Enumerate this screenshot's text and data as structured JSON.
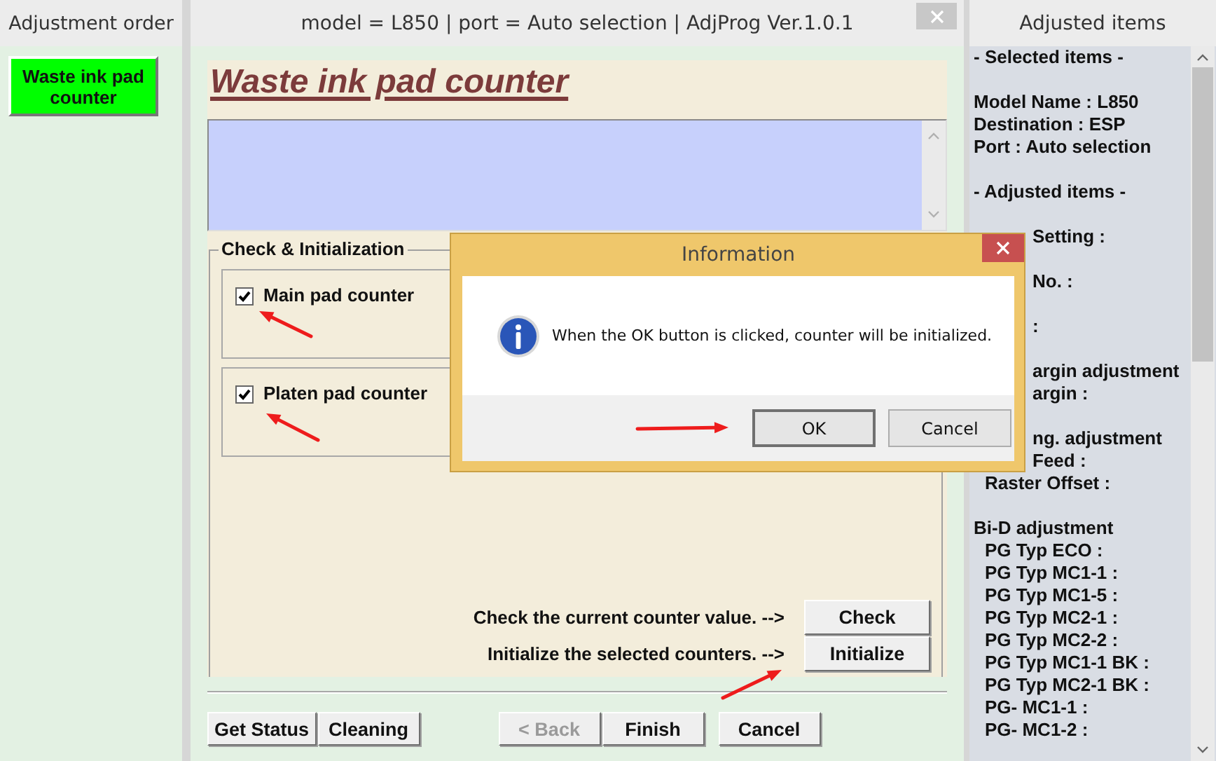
{
  "left_panel": {
    "title": "Adjustment order",
    "items": [
      {
        "label": "Waste ink pad counter",
        "selected": true
      }
    ]
  },
  "main": {
    "title": "model = L850 | port = Auto selection | AdjProg Ver.1.0.1",
    "heading": "Waste ink pad counter",
    "group_title": "Check & Initialization",
    "counters": [
      {
        "label": "Main pad counter",
        "checked": true
      },
      {
        "label": "Platen pad counter",
        "checked": true
      }
    ],
    "actions": [
      {
        "prompt": "Check the current counter value. -->",
        "button": "Check"
      },
      {
        "prompt": "Initialize the selected counters. -->",
        "button": "Initialize"
      }
    ],
    "footer_left": [
      {
        "label": "Get Status",
        "disabled": false
      },
      {
        "label": "Cleaning",
        "disabled": false
      }
    ],
    "footer_center": [
      {
        "label": "< Back",
        "disabled": true
      },
      {
        "label": "Finish",
        "disabled": false
      }
    ],
    "footer_right": [
      {
        "label": "Cancel",
        "disabled": false
      }
    ]
  },
  "right_panel": {
    "title": "Adjusted items",
    "sections": [
      {
        "lines": [
          {
            "text": "- Selected items -",
            "kind": "heading"
          }
        ]
      },
      {
        "lines": [
          {
            "text": "Model Name : L850",
            "kind": "item"
          },
          {
            "text": "Destination : ESP",
            "kind": "item"
          },
          {
            "text": "Port : Auto selection",
            "kind": "item"
          }
        ]
      },
      {
        "lines": [
          {
            "text": "- Adjusted items -",
            "kind": "heading"
          }
        ]
      },
      {
        "lines": [
          {
            "text": "Setting :",
            "kind": "clipped"
          }
        ]
      },
      {
        "lines": [
          {
            "text": "No. :",
            "kind": "clipped"
          }
        ]
      },
      {
        "lines": [
          {
            "text": ":",
            "kind": "clipped"
          }
        ]
      },
      {
        "lines": [
          {
            "text": "argin adjustment",
            "kind": "clipped"
          },
          {
            "text": "argin :",
            "kind": "clipped"
          }
        ]
      },
      {
        "lines": [
          {
            "text": "ng. adjustment",
            "kind": "clipped"
          },
          {
            "text": "Feed :",
            "kind": "clipped"
          },
          {
            "text": "Raster Offset :",
            "kind": "sub"
          }
        ]
      },
      {
        "lines": [
          {
            "text": "Bi-D adjustment",
            "kind": "heading"
          },
          {
            "text": "PG Typ ECO :",
            "kind": "sub"
          },
          {
            "text": "PG Typ MC1-1 :",
            "kind": "sub"
          },
          {
            "text": "PG Typ MC1-5 :",
            "kind": "sub"
          },
          {
            "text": "PG Typ MC2-1 :",
            "kind": "sub"
          },
          {
            "text": "PG Typ MC2-2 :",
            "kind": "sub"
          },
          {
            "text": "PG Typ MC1-1 BK :",
            "kind": "sub"
          },
          {
            "text": "PG Typ MC2-1 BK :",
            "kind": "sub"
          },
          {
            "text": "PG- MC1-1 :",
            "kind": "sub"
          },
          {
            "text": "PG- MC1-2 :",
            "kind": "sub"
          }
        ]
      }
    ]
  },
  "dialog": {
    "title": "Information",
    "message": "When the OK button is clicked, counter will be initialized.",
    "buttons": [
      {
        "label": "OK",
        "selected": true
      },
      {
        "label": "Cancel",
        "selected": false
      }
    ]
  }
}
